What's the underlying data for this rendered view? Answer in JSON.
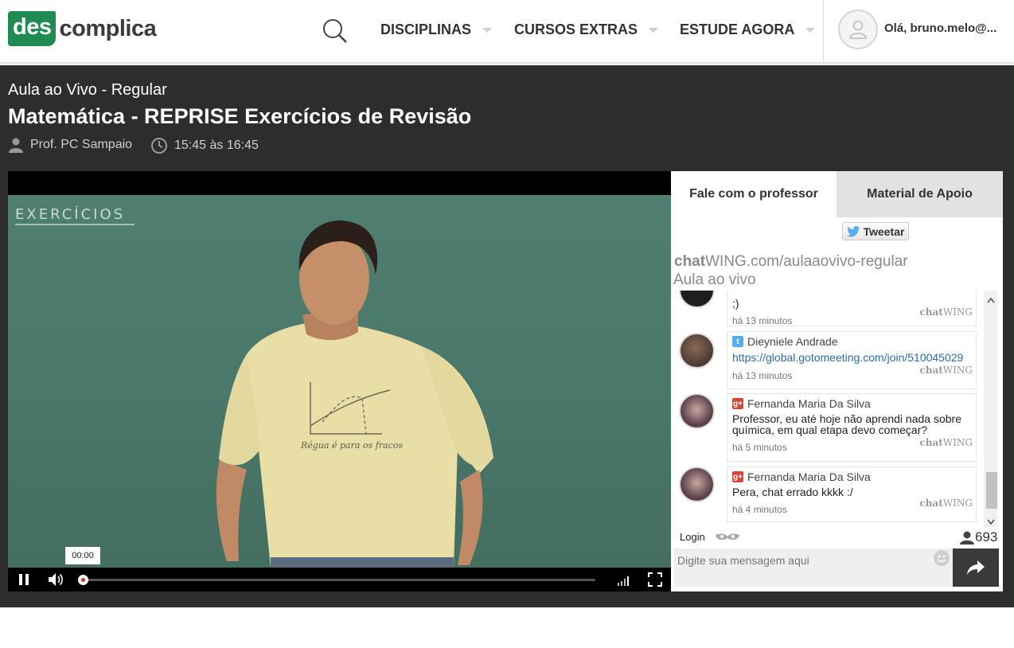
{
  "header": {
    "logo_box": "des",
    "logo_rest": "complica",
    "nav": [
      {
        "label": "DISCIPLINAS"
      },
      {
        "label": "CURSOS EXTRAS"
      },
      {
        "label": "ESTUDE AGORA"
      }
    ],
    "greeting": "Olá, bruno.melo@..."
  },
  "lesson": {
    "category": "Aula ao Vivo - Regular",
    "title": "Matemática - REPRISE Exercícios de Revisão",
    "teacher": "Prof. PC Sampaio",
    "schedule": "15:45 às 16:45"
  },
  "video": {
    "board_text": "EXERCÍCIOS",
    "shirt_text": "Régua é para os fracos",
    "current_time": "00:00",
    "progress_fraction": 0.0
  },
  "panel": {
    "tabs": [
      {
        "label": "Fale com o professor",
        "active": true
      },
      {
        "label": "Material de Apoio",
        "active": false
      }
    ],
    "tweet_label": "Tweetar",
    "chatwing_brand": "chat",
    "chatwing_url": "WING.com/aulaaovivo-regular",
    "chatwing_sub": "Aula ao vivo",
    "messages": [
      {
        "name": "",
        "text": ";)",
        "time": "há 13 minutos",
        "brand_bold": "chat",
        "brand": "WING"
      },
      {
        "name": "Dieyniele Andrade",
        "source": "twitter",
        "link": "https://global.gotomeeting.com/join/510045029",
        "time": "há 13 minutos",
        "brand_bold": "chat",
        "brand": "WING"
      },
      {
        "name": "Fernanda Maria Da Silva",
        "source": "google-plus",
        "text": "Professor, eu até hoje não aprendi nada sobre química, em qual etapa devo começar?",
        "time": "há 5 minutos",
        "brand_bold": "chat",
        "brand": "WING"
      },
      {
        "name": "Fernanda Maria Da Silva",
        "source": "google-plus",
        "text": "Pera, chat errado kkkk :/",
        "time": "há 4 minutos",
        "brand_bold": "chat",
        "brand": "WING"
      }
    ],
    "login_label": "Login",
    "online_count": "693",
    "input_placeholder": "Digite sua mensagem aqui",
    "colors": {
      "google_plus": "#d34836",
      "twitter": "#55acee",
      "link": "#2a6ab1"
    }
  }
}
